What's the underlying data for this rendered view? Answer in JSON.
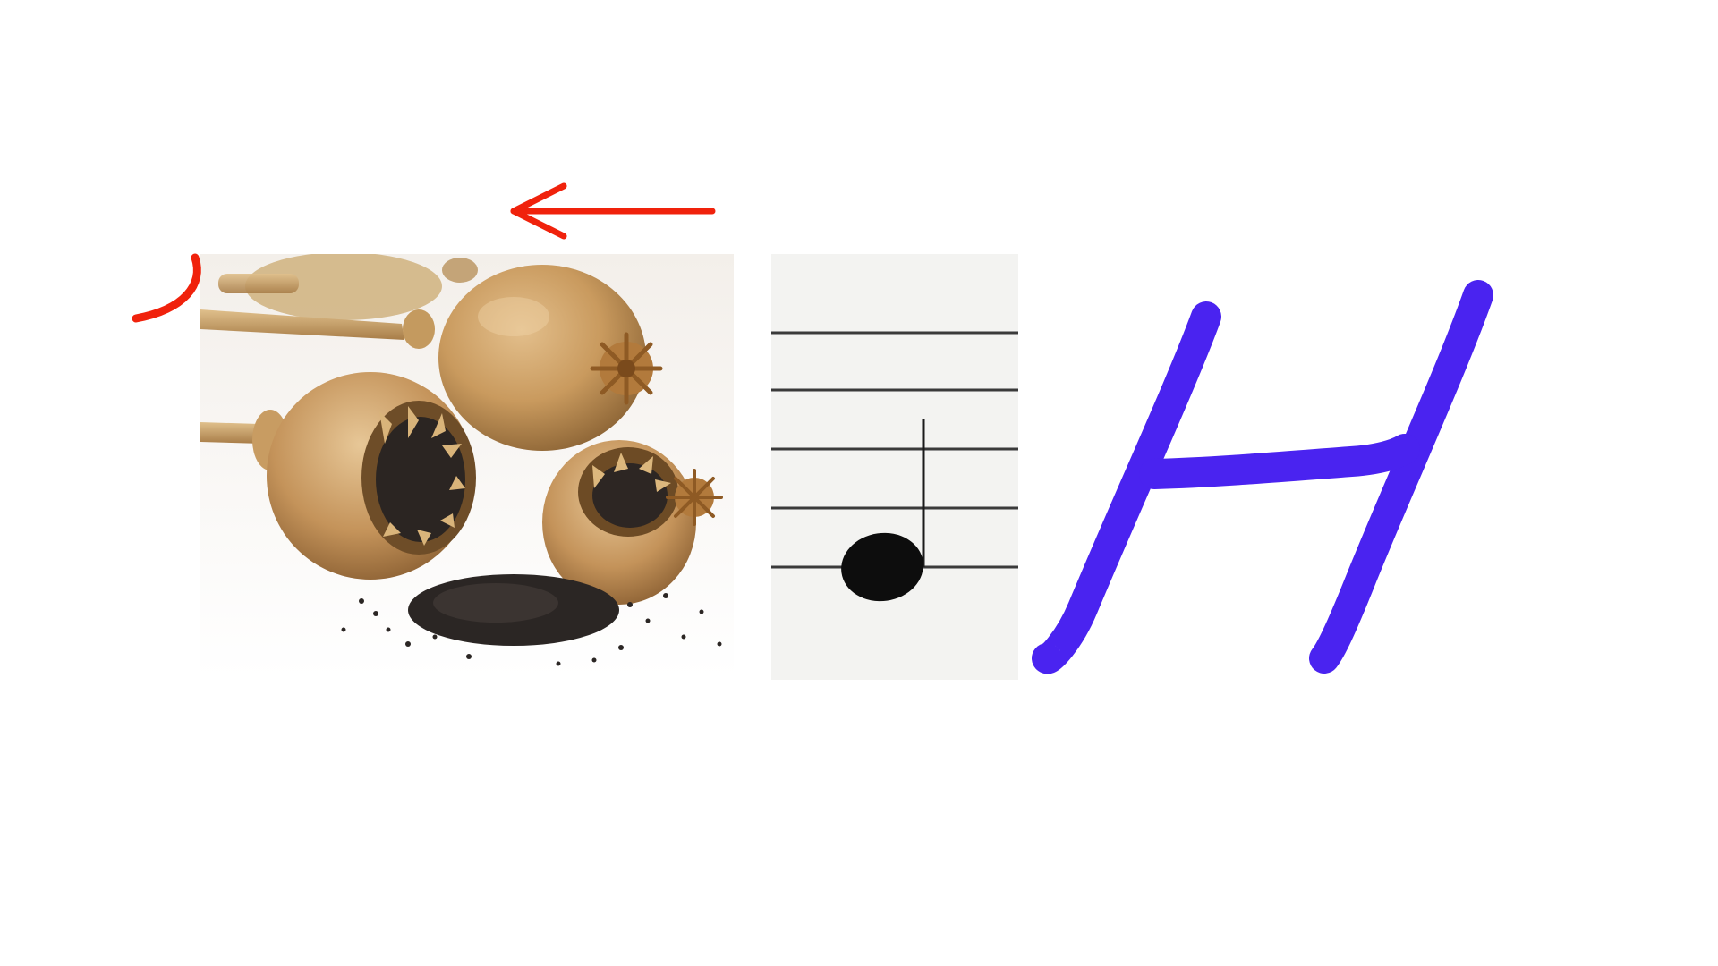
{
  "rebus": {
    "images": [
      {
        "icon": "poppy-seed-pods-photo"
      },
      {
        "icon": "musical-quarter-note-icon"
      }
    ],
    "letter": "H",
    "annotation_marks": [
      {
        "icon": "left-arrow-icon",
        "color": "#f0220c"
      },
      {
        "icon": "comma-mark-icon",
        "color": "#f0220c"
      }
    ],
    "colors": {
      "letter": "#4a23f0",
      "annotation": "#f0220c",
      "background": "#ffffff"
    }
  }
}
